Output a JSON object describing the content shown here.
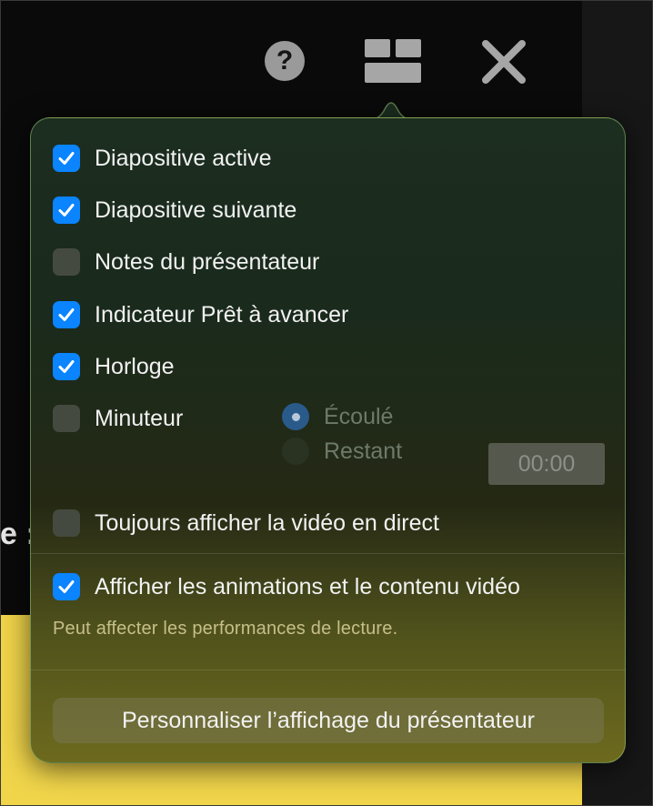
{
  "toolbar": {
    "help_icon": "question-mark-icon",
    "help_glyph": "?",
    "layout_icon": "layout-grid-icon",
    "close_icon": "close-x-icon"
  },
  "background": {
    "fragment_text": "e :"
  },
  "popover": {
    "options": [
      {
        "label": "Diapositive active",
        "checked": true
      },
      {
        "label": "Diapositive suivante",
        "checked": true
      },
      {
        "label": "Notes du présentateur",
        "checked": false
      },
      {
        "label": "Indicateur Prêt à avancer",
        "checked": true
      },
      {
        "label": "Horloge",
        "checked": true
      },
      {
        "label": "Minuteur",
        "checked": false
      }
    ],
    "timer_modes": [
      {
        "label": "Écoulé",
        "selected": true
      },
      {
        "label": "Restant",
        "selected": false
      }
    ],
    "timer_value": "00:00",
    "live_video": {
      "label": "Toujours afficher la vidéo en direct",
      "checked": false
    },
    "animations": {
      "label": "Afficher les animations et le contenu vidéo",
      "checked": true
    },
    "animations_note": "Peut affecter les performances de lecture.",
    "customize_button": "Personnaliser l’affichage du présentateur"
  },
  "colors": {
    "accent": "#0a84ff",
    "background_yellow": "#f0d44a"
  }
}
